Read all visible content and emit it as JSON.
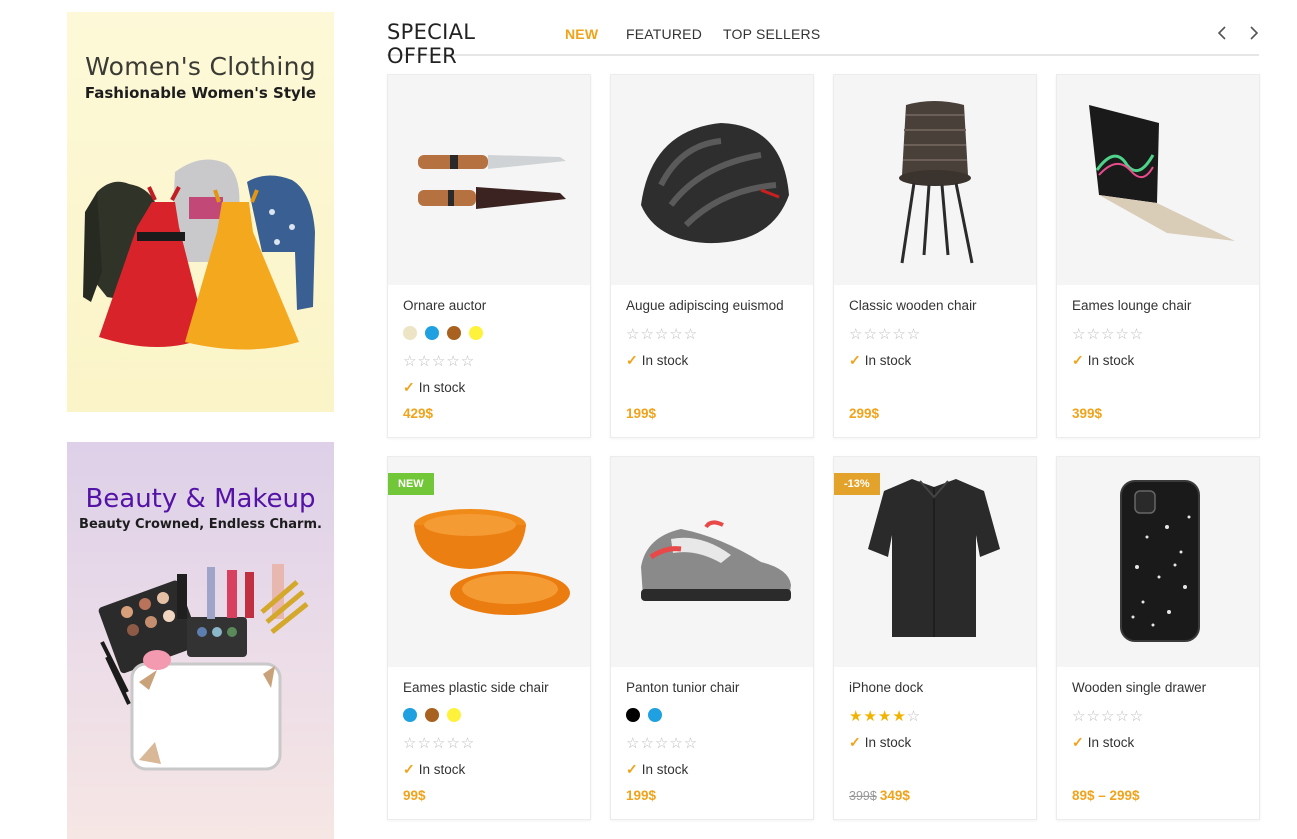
{
  "banners": {
    "women": {
      "title": "Women's Clothing",
      "subtitle": "Fashionable Women's Style"
    },
    "beauty": {
      "title": "Beauty & Makeup",
      "subtitle": "Beauty Crowned, Endless Charm."
    }
  },
  "tabs": {
    "section_title": "SPECIAL OFFER",
    "items": [
      {
        "label": "NEW",
        "active": true
      },
      {
        "label": "FEATURED",
        "active": false
      },
      {
        "label": "TOP SELLERS",
        "active": false
      }
    ],
    "prev_icon": "chevron-left-icon",
    "next_icon": "chevron-right-icon"
  },
  "colors": {
    "accent": "#f0a31b",
    "badge_new": "#71c738",
    "badge_sale": "#e3a32a",
    "star_filled": "#f0b400"
  },
  "products": [
    {
      "name": "Ornare auctor",
      "swatches": [
        "#ece4c4",
        "#1fa0e0",
        "#a9611f",
        "#fff23a"
      ],
      "rating": 0,
      "stock": "In stock",
      "price": "429$",
      "old_price": "",
      "badge": ""
    },
    {
      "name": "Augue adipiscing euismod",
      "swatches": [],
      "rating": 0,
      "stock": "In stock",
      "price": "199$",
      "old_price": "",
      "badge": ""
    },
    {
      "name": "Classic wooden chair",
      "swatches": [],
      "rating": 0,
      "stock": "In stock",
      "price": "299$",
      "old_price": "",
      "badge": ""
    },
    {
      "name": "Eames lounge chair",
      "swatches": [],
      "rating": 0,
      "stock": "In stock",
      "price": "399$",
      "old_price": "",
      "badge": ""
    },
    {
      "name": "Eames plastic side chair",
      "swatches": [
        "#1fa0e0",
        "#a9611f",
        "#fff23a"
      ],
      "rating": 0,
      "stock": "In stock",
      "price": "99$",
      "old_price": "",
      "badge": "NEW"
    },
    {
      "name": "Panton tunior chair",
      "swatches": [
        "#000000",
        "#1fa0e0"
      ],
      "rating": 0,
      "stock": "In stock",
      "price": "199$",
      "old_price": "",
      "badge": ""
    },
    {
      "name": "iPhone dock",
      "swatches": [],
      "rating": 4,
      "stock": "In stock",
      "price": "349$",
      "old_price": "399$",
      "badge": "-13%"
    },
    {
      "name": "Wooden single drawer",
      "swatches": [],
      "rating": 0,
      "stock": "In stock",
      "price": "89$ – 299$",
      "old_price": "",
      "badge": ""
    }
  ]
}
